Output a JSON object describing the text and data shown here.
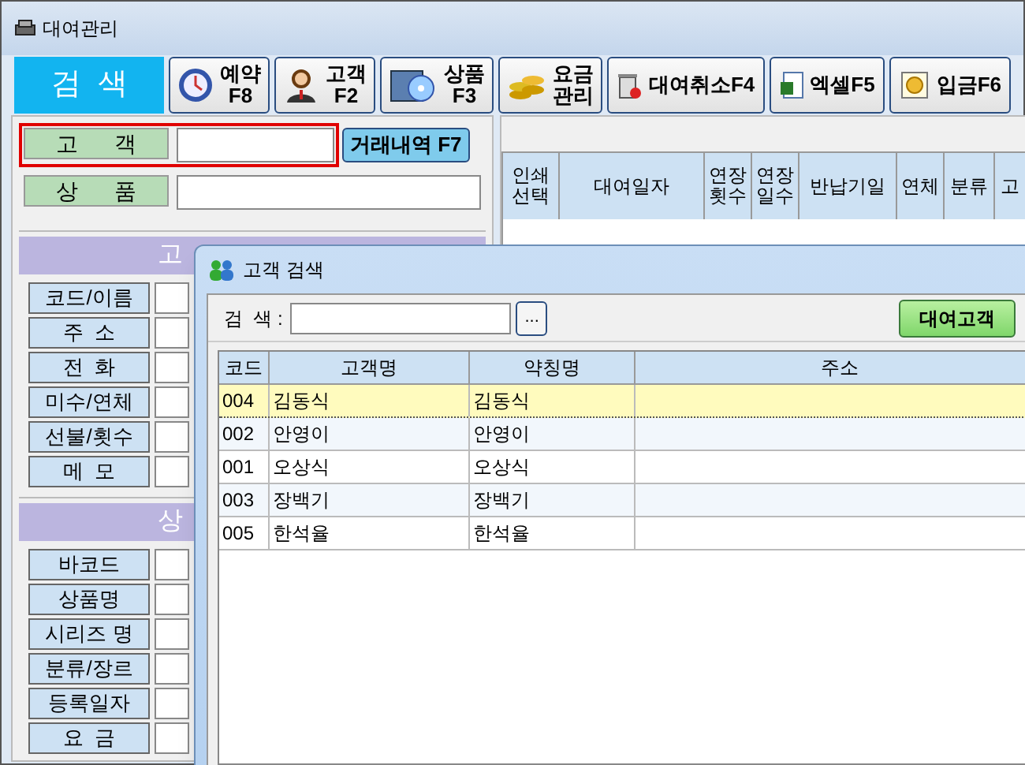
{
  "window": {
    "title": "대여관리"
  },
  "toolbar": [
    {
      "kind": "primary",
      "lines": [
        "검  색"
      ]
    },
    {
      "kind": "tool",
      "lines": [
        "예약",
        "F8"
      ]
    },
    {
      "kind": "tool",
      "lines": [
        "고객",
        "F2"
      ]
    },
    {
      "kind": "tool",
      "lines": [
        "상품",
        "F3"
      ]
    },
    {
      "kind": "tool",
      "lines": [
        "요금",
        "관리"
      ]
    },
    {
      "kind": "tool",
      "lines": [
        "대여취소F4"
      ]
    },
    {
      "kind": "tool",
      "lines": [
        "엑셀F5"
      ]
    },
    {
      "kind": "tool",
      "lines": [
        "입금F6"
      ]
    }
  ],
  "search_fields": [
    {
      "label": "고      객",
      "highlighted": true
    },
    {
      "label": "상      품",
      "highlighted": false
    }
  ],
  "history_button": "거래내역 F7",
  "sections": [
    {
      "title": "고",
      "fields": [
        "코드/이름",
        "주  소",
        "전  화",
        "미수/연체",
        "선불/횟수",
        "메  모"
      ]
    },
    {
      "title": "상",
      "fields": [
        "바코드",
        "상품명",
        "시리즈 명",
        "분류/장르",
        "등록일자",
        "요  금"
      ]
    }
  ],
  "rental_table": {
    "columns": [
      "인쇄선택",
      "대여일자",
      "연장횟수",
      "연장일수",
      "반납기일",
      "연체",
      "분류",
      "고"
    ]
  },
  "dialog": {
    "title": "고객 검색",
    "search_label": "검  색 :",
    "browse_button": "...",
    "rental_button": "대여고객",
    "columns": [
      "코드",
      "고객명",
      "약칭명",
      "주소"
    ],
    "rows": [
      {
        "code": "004",
        "name": "김동식",
        "alias": "김동식",
        "selected": true
      },
      {
        "code": "002",
        "name": "안영이",
        "alias": "안영이",
        "selected": false
      },
      {
        "code": "001",
        "name": "오상식",
        "alias": "오상식",
        "selected": false
      },
      {
        "code": "003",
        "name": "장백기",
        "alias": "장백기",
        "selected": false
      },
      {
        "code": "005",
        "name": "한석율",
        "alias": "한석율",
        "selected": false
      }
    ]
  }
}
